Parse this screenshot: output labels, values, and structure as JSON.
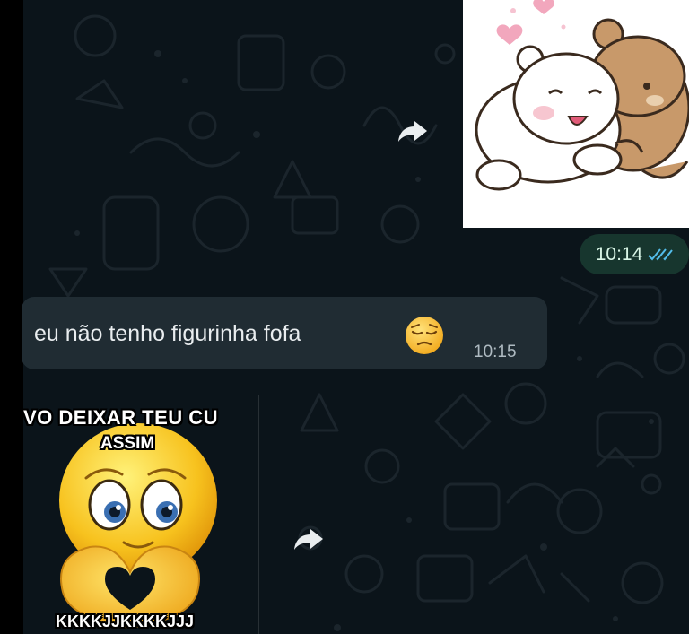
{
  "chat": {
    "sent_time": "10:14",
    "received_message": {
      "text": "eu não tenho figurinha fofa",
      "emoji": "pensive-face-emoji",
      "time": "10:15"
    },
    "meme_sticker": {
      "caption_top": "VO DEIXAR TEU CU",
      "caption_mid": "ASSIM",
      "caption_bottom": "KKKKJJKKKKJJJ"
    }
  },
  "colors": {
    "chat_background": "#0b141a",
    "incoming_bubble": "#202c33",
    "outgoing_time_pill": "#193a30",
    "read_ticks": "#53bdeb"
  }
}
